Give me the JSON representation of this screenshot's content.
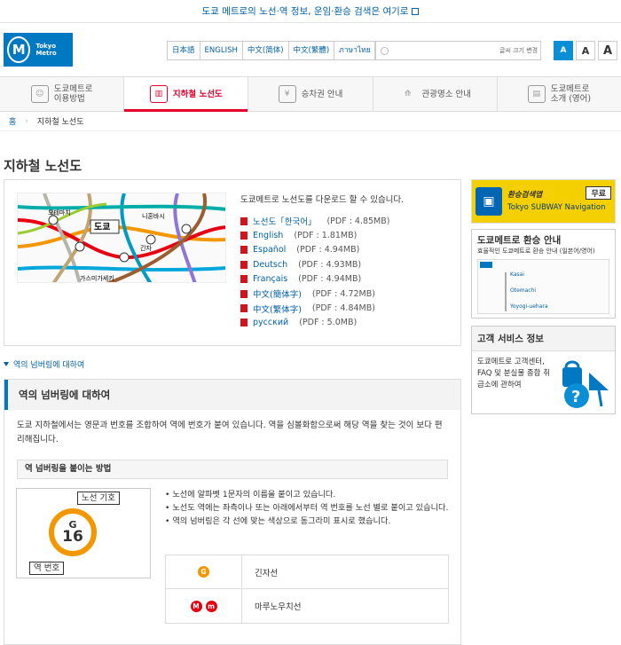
{
  "topbar": {
    "notice": "도쿄 메트로의 노선·역 정보, 운임·환승 검색은 여기로"
  },
  "logo": {
    "mark": "M",
    "text": "Tokyo Metro"
  },
  "languages": [
    "日本語",
    "ENGLISH",
    "中文(简体)",
    "中文(繁體)",
    "ภาษาไทย"
  ],
  "search": {
    "placeholder": ""
  },
  "font_size": {
    "label": "글씨 크기 변경",
    "buttons": [
      "A",
      "A",
      "A"
    ]
  },
  "nav": [
    {
      "label": "도쿄메트로\n이용방법",
      "icon": "guide-icon"
    },
    {
      "label": "지하철 노선도",
      "icon": "map-icon"
    },
    {
      "label": "승차권 안내",
      "icon": "ticket-icon"
    },
    {
      "label": "관광명소 안내",
      "icon": "tower-icon"
    },
    {
      "label": "도쿄메트로\n소개 (영어)",
      "icon": "building-icon"
    }
  ],
  "breadcrumb": {
    "home": "홈",
    "current": "지하철 노선도"
  },
  "page_title": "지하철 노선도",
  "map_labels": [
    "오테마치",
    "도쿄",
    "긴자",
    "니혼바시",
    "가스미가세키"
  ],
  "downloads": {
    "intro": "도쿄메트로 노선도를 다운로드 할 수 있습니다.",
    "items": [
      {
        "name": "노선도「한국어」",
        "size": "(PDF : 4.85MB)"
      },
      {
        "name": "English",
        "size": "(PDF : 1.81MB)"
      },
      {
        "name": "Español",
        "size": "(PDF : 4.94MB)"
      },
      {
        "name": "Deutsch",
        "size": "(PDF : 4.93MB)"
      },
      {
        "name": "Français",
        "size": "(PDF : 4.94MB)"
      },
      {
        "name": "中文(簡体字)",
        "size": "(PDF : 4.72MB)"
      },
      {
        "name": "中文(繁体字)",
        "size": "(PDF : 4.84MB)"
      },
      {
        "name": "русский",
        "size": "(PDF : 5.0MB)"
      }
    ]
  },
  "anchor_link": "역의 넘버링에 대하여",
  "numbering": {
    "heading": "역의 넘버링에 대하여",
    "body": "도쿄 지하철에서는 영문과 번호를 조합하여 역에 번호가 붙여 있습니다. 역을 심볼화함으로써 해당 역을 찾는 것이 보다 편리해집니다.",
    "subheading": "역 넘버링을 붙이는 방법",
    "example": {
      "letter": "G",
      "number": "16",
      "line_label": "노선 기호",
      "station_label": "역 번호"
    },
    "bullets": [
      "• 노선에 알파벳 1문자의 이름을 붙이고 있습니다.",
      "• 노선도 역에는 좌측이나 또는 아래에서부터 역 번호를 노선 별로 붙이고 있습니다.",
      "• 역의 넘버링은 각 선에 맞는 색상으로 동그라미 표시로 했습니다."
    ],
    "lines": [
      {
        "codes": [
          "G"
        ],
        "colors": [
          "#f39700"
        ],
        "name": "긴자선"
      },
      {
        "codes": [
          "M",
          "m"
        ],
        "colors": [
          "#e60012",
          "#e60012"
        ],
        "name": "마루노우치선"
      }
    ]
  },
  "sidebar": {
    "transfer_banner": {
      "title": "환승검색앱",
      "subtitle": "Tokyo SUBWAY Navigation",
      "badge": "무료"
    },
    "transfer_guide": {
      "title": "도쿄메트로 환승 안내",
      "subtitle": "효율적인 도쿄메트로 환승 안내 (일본어/영어)",
      "stations": [
        "Kasai",
        "Otemachi",
        "Yoyogi-uehara"
      ]
    },
    "customer": {
      "title": "고객 서비스 정보",
      "body": "도쿄메트로 고객센터, FAQ 및 분실물 종합 취급소에 관하여"
    }
  }
}
